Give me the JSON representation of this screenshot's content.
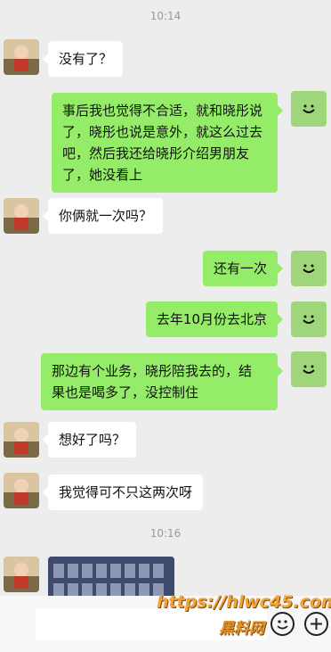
{
  "timestamps": {
    "first": "10:14",
    "second": "10:16"
  },
  "messages": {
    "m1": {
      "text": "没有了？"
    },
    "m2": {
      "lines": [
        "事后我也觉得不合适，就和晓彤说",
        "了，晓彤也说是意外，就这么过去",
        "吧，然后我还给晓彤介绍男朋友",
        "了，她没看上"
      ]
    },
    "m3": {
      "text": "你俩就一次吗？"
    },
    "m4": {
      "text": "还有一次"
    },
    "m5": {
      "text": "去年10月份去北京"
    },
    "m6": {
      "lines": [
        "那边有个业务，晓彤陪我去的，结",
        "果也是喝多了，没控制住"
      ]
    },
    "m7": {
      "text": "想好了吗？"
    },
    "m8": {
      "text": "我觉得可不只这两次呀"
    }
  },
  "watermark": {
    "line1": "https://hlwc45.com",
    "line2": "黑料网"
  },
  "colors": {
    "background": "#ededed",
    "outgoing_bubble": "#95ec69",
    "incoming_bubble": "#ffffff",
    "self_avatar": "#9fd67c"
  },
  "icons": {
    "emoji_button": "smiley-icon",
    "more_button": "plus-icon",
    "self_avatar": "smile-face-icon"
  }
}
